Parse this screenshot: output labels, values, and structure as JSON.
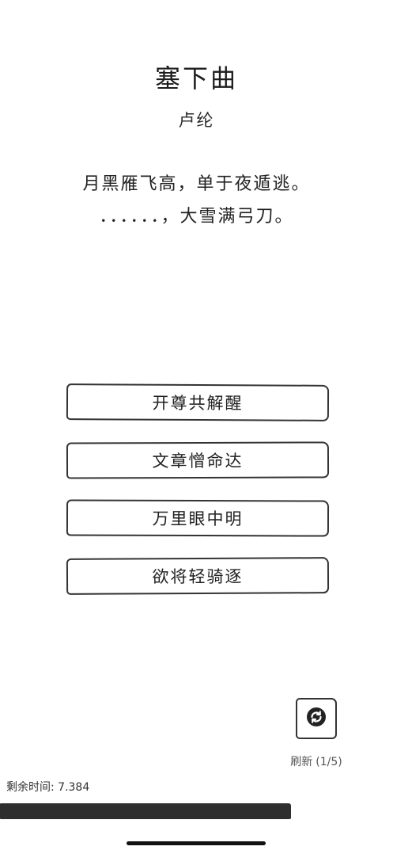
{
  "poem": {
    "title": "塞下曲",
    "author": "卢纶",
    "line1": "月黑雁飞高，单于夜遁逃。",
    "line2": "．．．．．．，大雪满弓刀。"
  },
  "options": [
    {
      "label": "开尊共解醒"
    },
    {
      "label": "文章憎命达"
    },
    {
      "label": "万里眼中明"
    },
    {
      "label": "欲将轻骑逐"
    }
  ],
  "refresh": {
    "label": "刷新",
    "count": "(1/5)",
    "icon": "refresh-icon"
  },
  "timer": {
    "text": "剩余时间: 7.384",
    "progress": 0.74
  },
  "colors": {
    "ink": "#2e2e2e",
    "background": "#ffffff"
  }
}
